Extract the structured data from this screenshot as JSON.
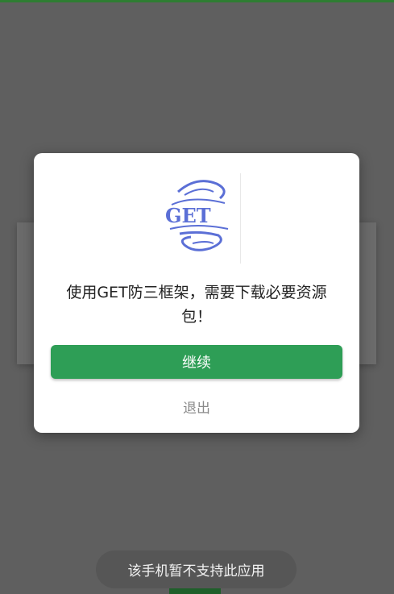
{
  "dialog": {
    "logo_text": "GET",
    "message": "使用GET防三框架，需要下载必要资源包！",
    "continue_label": "继续",
    "exit_label": "退出"
  },
  "toast": {
    "text": "该手机暂不支持此应用"
  },
  "colors": {
    "overlay": "#5f5f5f",
    "accent_green": "#2e9e56",
    "logo_blue": "#5b6fd6"
  }
}
